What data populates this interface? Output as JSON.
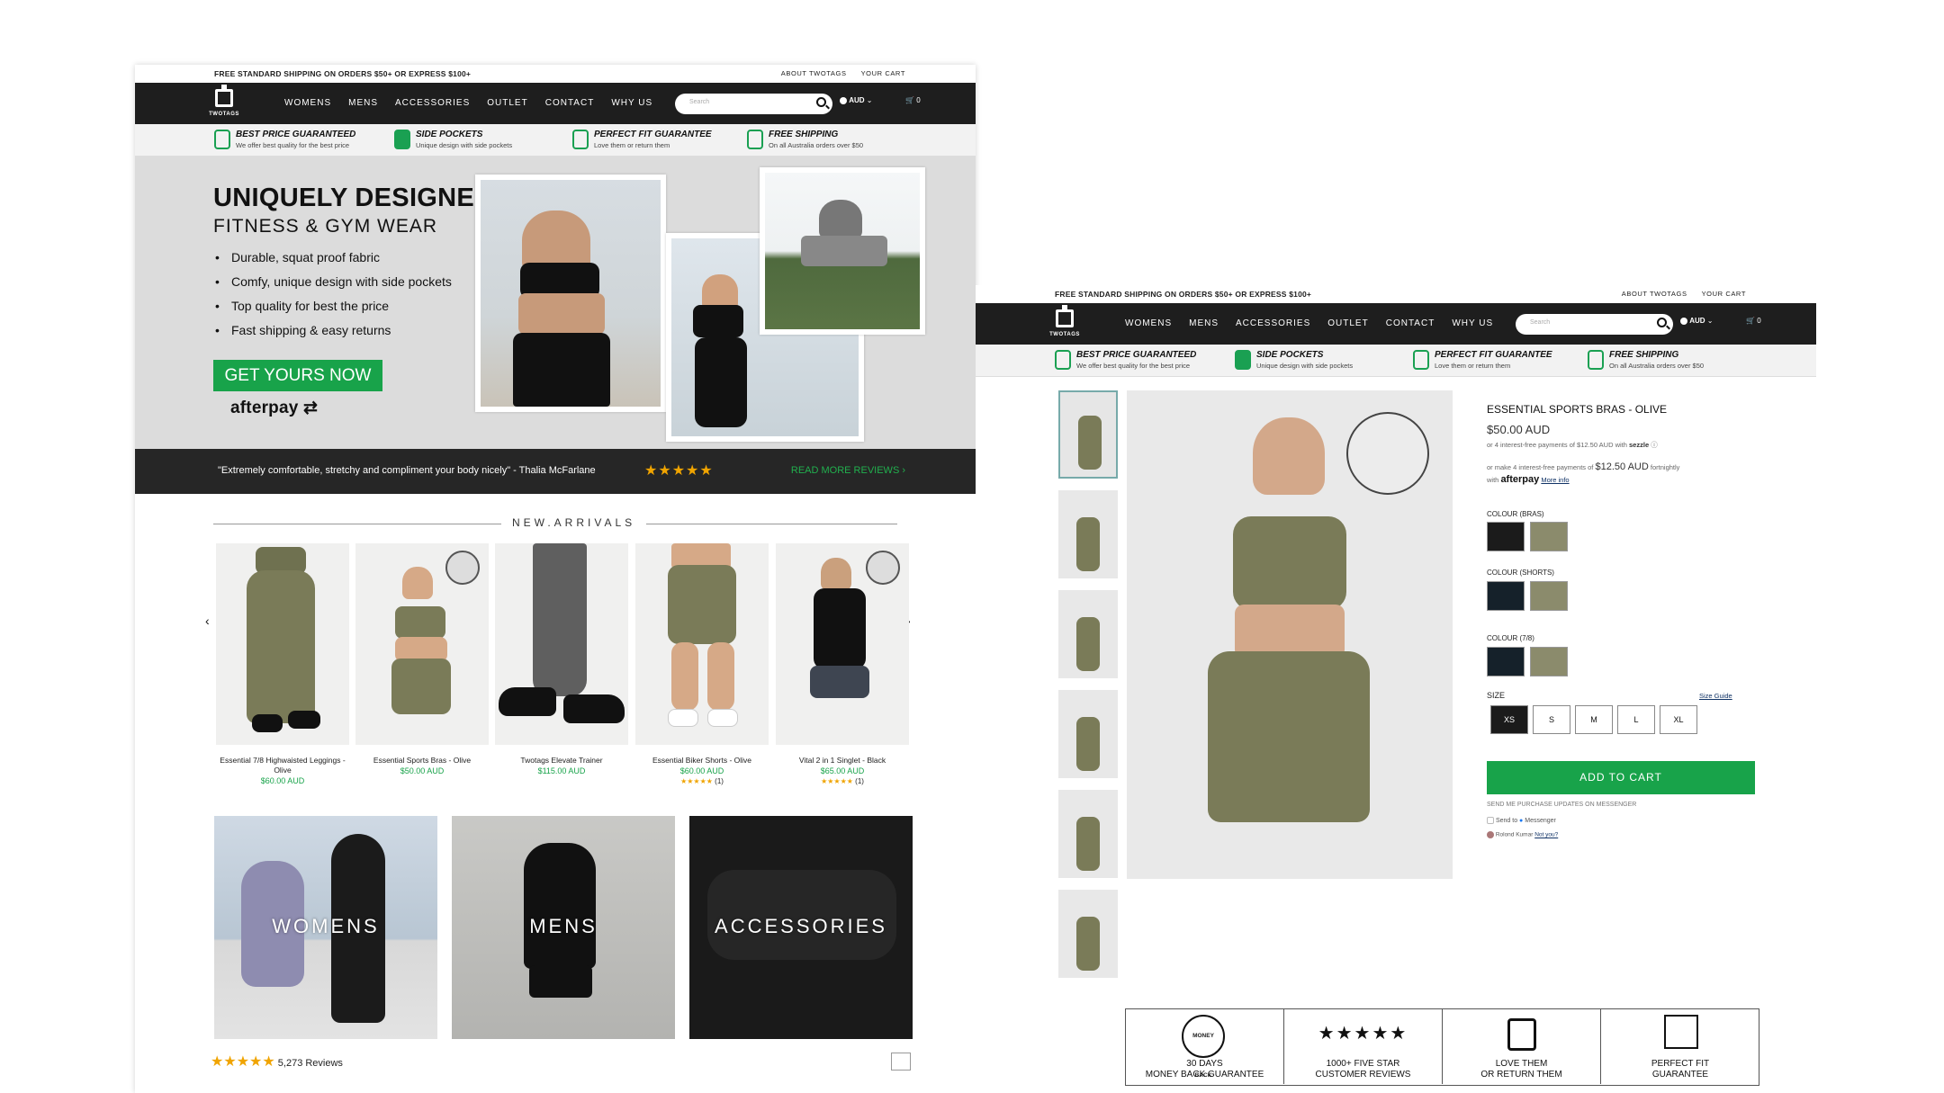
{
  "colors": {
    "brand_green": "#18a34a",
    "nav_bg": "#1e1e1e",
    "star": "#f0a400",
    "olive": "#7d7d5a"
  },
  "topbar": {
    "shipping": "FREE STANDARD SHIPPING ON ORDERS $50+ OR EXPRESS $100+",
    "about": "ABOUT TWOTAGS",
    "cart": "YOUR CART"
  },
  "nav": {
    "logo_text": "TWOTAGS",
    "items": [
      "WOMENS",
      "MENS",
      "ACCESSORIES",
      "OUTLET",
      "CONTACT",
      "WHY US"
    ],
    "search_placeholder": "Search",
    "currency": "AUD",
    "cart_count": "0"
  },
  "usps": [
    {
      "icon": "badge-icon",
      "title": "BEST PRICE GUARANTEED",
      "sub": "We offer best quality for the best price"
    },
    {
      "icon": "pocket-icon",
      "title": "SIDE POCKETS",
      "sub": "Unique design with side pockets"
    },
    {
      "icon": "puzzle-icon",
      "title": "PERFECT FIT GUARANTEE",
      "sub": "Love them or return them"
    },
    {
      "icon": "truck-icon",
      "title": "FREE SHIPPING",
      "sub": "On all Australia orders over $50"
    }
  ],
  "hero": {
    "title": "UNIQUELY DESIGNED",
    "subtitle": "FITNESS & GYM WEAR",
    "bullets": [
      "Durable, squat proof fabric",
      "Comfy, unique design with side pockets",
      "Top quality for best the price",
      "Fast shipping & easy returns"
    ],
    "cta": "GET YOURS NOW",
    "afterpay": "afterpay"
  },
  "review": {
    "quote": "\"Extremely comfortable, stretchy and compliment your body nicely\" - Thalia McFarlane",
    "stars": "★★★★★",
    "more": "READ MORE REVIEWS ›"
  },
  "new_arrivals": {
    "title": "NEW.ARRIVALS",
    "products": [
      {
        "name": "Essential 7/8 Highwaisted Leggings - Olive",
        "price": "$60.00 AUD",
        "rating": "",
        "count": ""
      },
      {
        "name": "Essential Sports Bras - Olive",
        "price": "$50.00 AUD",
        "rating": "",
        "count": ""
      },
      {
        "name": "Twotags Elevate Trainer",
        "price": "$115.00 AUD",
        "rating": "",
        "count": ""
      },
      {
        "name": "Essential Biker Shorts - Olive",
        "price": "$60.00 AUD",
        "rating": "★★★★★",
        "count": "(1)"
      },
      {
        "name": "Vital 2 in 1 Singlet - Black",
        "price": "$65.00 AUD",
        "rating": "★★★★★",
        "count": "(1)"
      }
    ]
  },
  "categories": [
    "WOMENS",
    "MENS",
    "ACCESSORIES"
  ],
  "reviews_summary": {
    "stars": "★★★★★",
    "count": "5,273 Reviews"
  },
  "product": {
    "title": "ESSENTIAL SPORTS BRAS - OLIVE",
    "price": "$50.00 AUD",
    "sezzle_text": "or 4 interest-free payments of $12.50 AUD with",
    "sezzle": "sezzle",
    "afterpay_pre": "or make 4 interest-free payments of",
    "afterpay_amount": "$12.50 AUD",
    "afterpay_post": "fortnightly",
    "afterpay_with": "with",
    "afterpay": "afterpay",
    "more_info": "More info",
    "colour_bras": "COLOUR (BRAS)",
    "colour_shorts": "COLOUR (SHORTS)",
    "colour_78": "COLOUR (7/8)",
    "size_label": "SIZE",
    "size_guide": "Size Guide",
    "sizes": [
      "XS",
      "S",
      "M",
      "L",
      "XL"
    ],
    "selected_size": "XS",
    "add_to_cart": "ADD TO CART",
    "messenger_label": "SEND ME PURCHASE UPDATES ON MESSENGER",
    "send_to": "Send to",
    "messenger": "Messenger",
    "user": "Rolond Kumar",
    "not_you": "Not you?"
  },
  "trust": [
    {
      "icon": "money-back-seal-icon",
      "line1": "30 DAYS",
      "line2": "MONEY BACK GUARANTEE",
      "seal": "MONEY BACK"
    },
    {
      "icon": "five-stars-icon",
      "line1": "1000+ FIVE STAR",
      "line2": "CUSTOMER REVIEWS",
      "stars": "★★★★★"
    },
    {
      "icon": "return-box-icon",
      "line1": "LOVE THEM",
      "line2": "OR RETURN THEM"
    },
    {
      "icon": "puzzle-icon",
      "line1": "PERFECT FIT",
      "line2": "GUARANTEE"
    }
  ]
}
